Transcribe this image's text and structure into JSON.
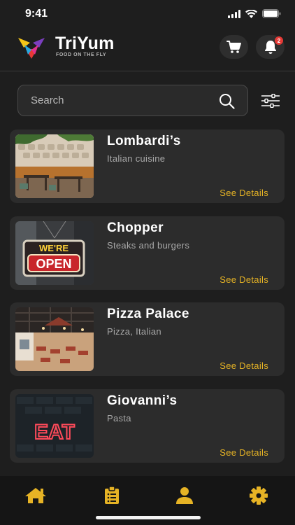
{
  "status_bar": {
    "time": "9:41"
  },
  "brand": {
    "name": "TriYum",
    "tagline": "FOOD ON THE FLY"
  },
  "header": {
    "notification_count": "2"
  },
  "search": {
    "placeholder": "Search",
    "value": ""
  },
  "restaurants": [
    {
      "name": "Lombardi’s",
      "cuisine": "Italian cuisine",
      "link": "See Details",
      "image": "restaurant-interior-photo"
    },
    {
      "name": "Chopper",
      "cuisine": "Steaks and burgers",
      "link": "See Details",
      "image": "open-neon-sign-photo",
      "sign_top": "WE'RE",
      "sign_main": "OPEN"
    },
    {
      "name": "Pizza Palace",
      "cuisine": "Pizza, Italian",
      "link": "See Details",
      "image": "restaurant-dining-room-photo"
    },
    {
      "name": "Giovanni’s",
      "cuisine": "Pasta",
      "link": "See Details",
      "image": "eat-neon-sign-photo",
      "sign_main": "EAT"
    }
  ],
  "tab_bar": {
    "tabs": [
      "home",
      "orders",
      "profile",
      "settings"
    ],
    "active": "home"
  },
  "colors": {
    "background": "#1e1e1e",
    "card": "#2c2c2c",
    "accent": "#e6b325",
    "tab_bar": "#151515",
    "badge": "#e53935"
  }
}
